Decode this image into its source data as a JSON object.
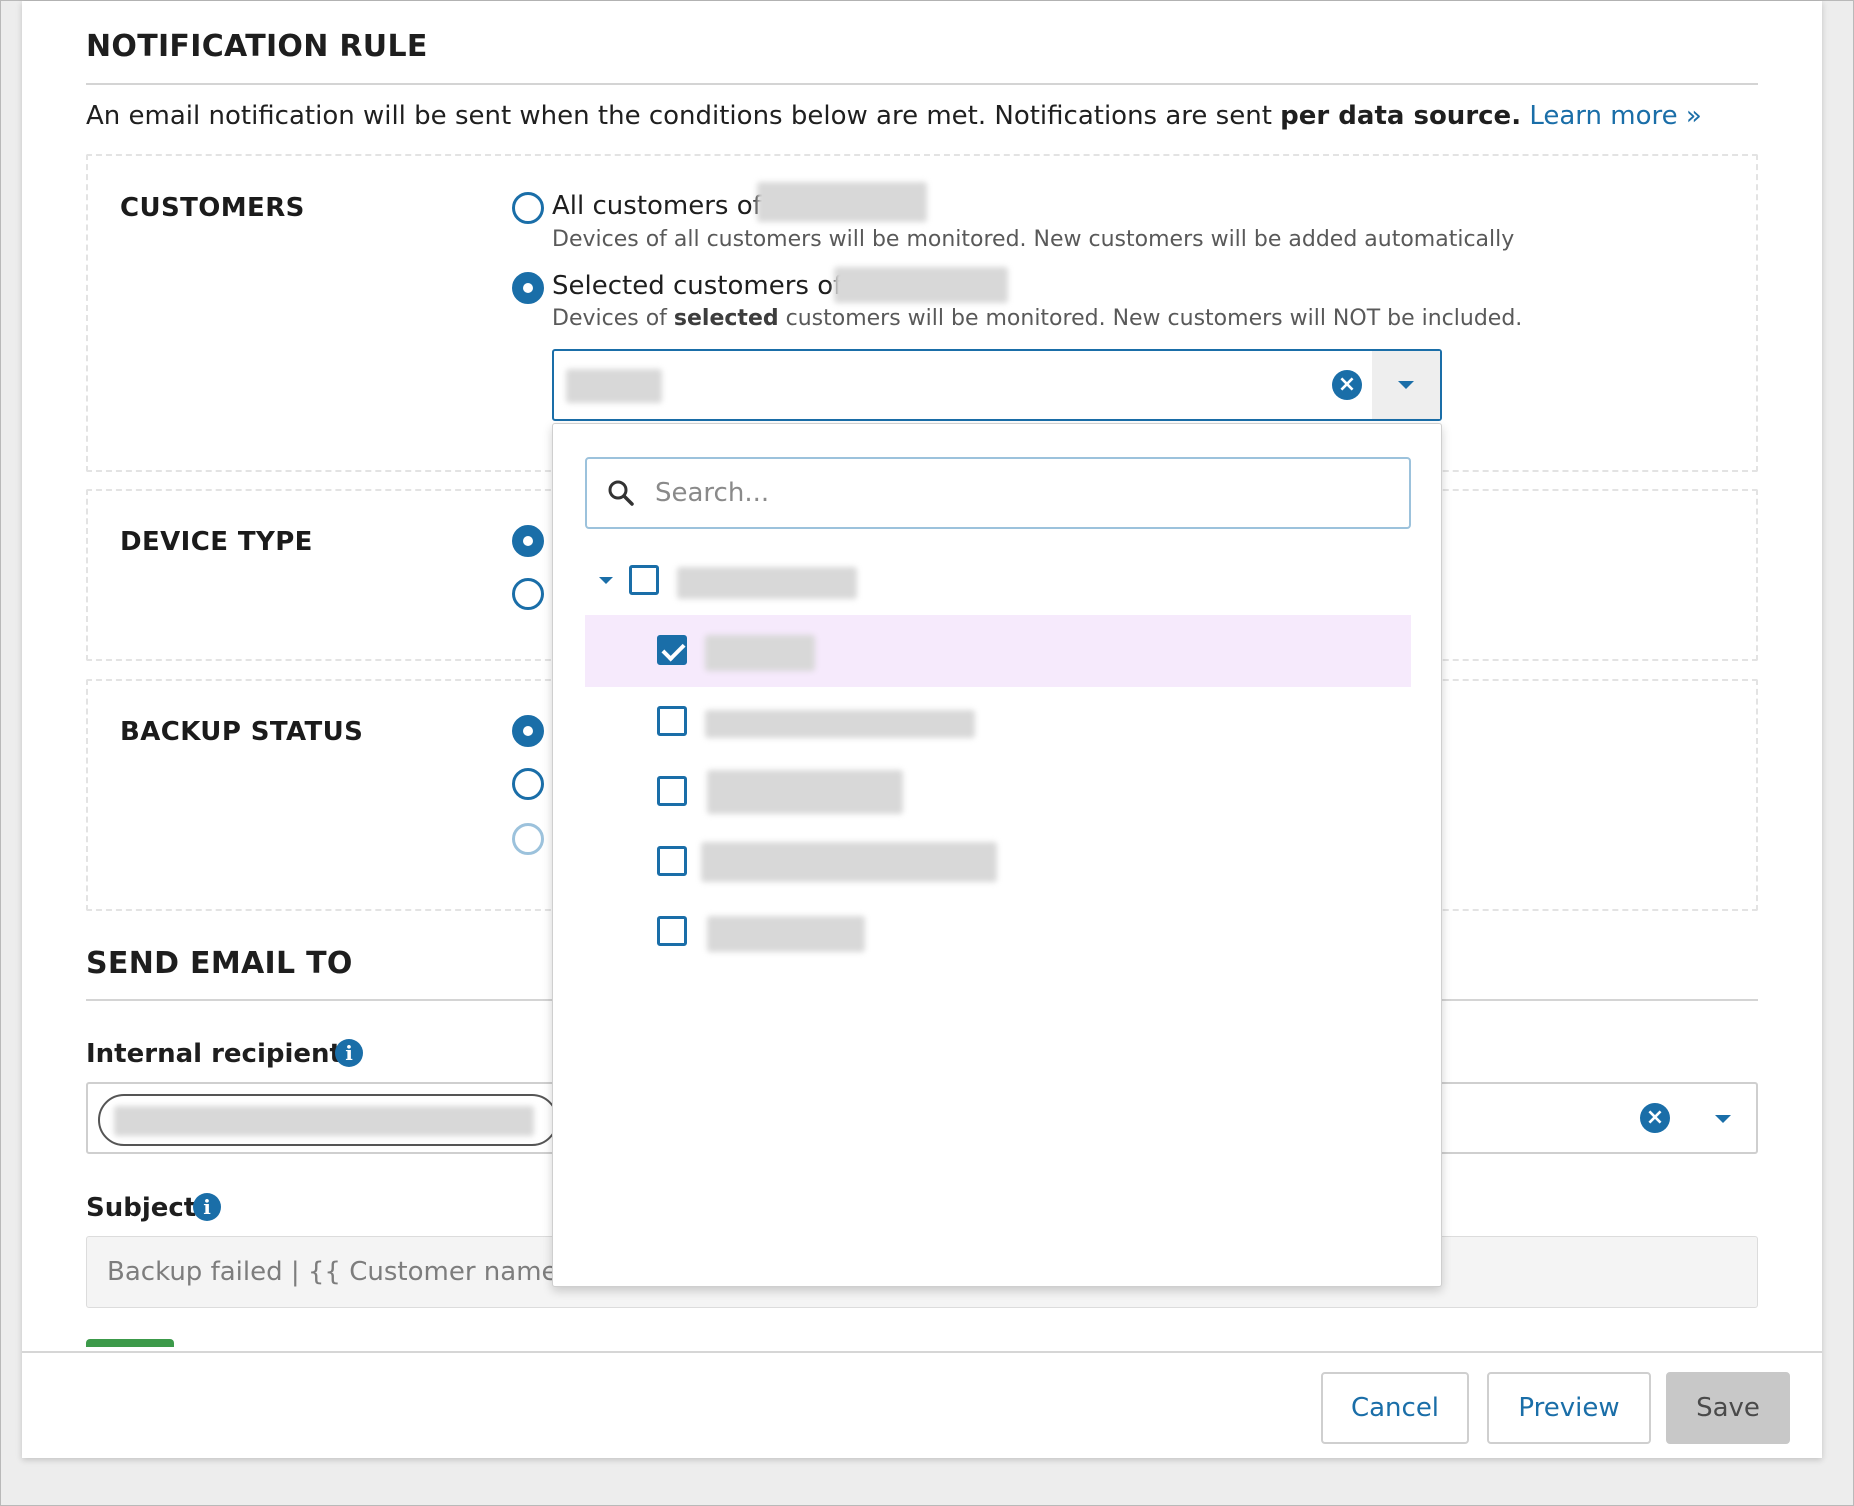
{
  "rule": {
    "title": "NOTIFICATION RULE",
    "intro_text": "An email notification will be sent when the conditions below are met. Notifications are sent ",
    "intro_bold": "per data source.",
    "learn_more": "Learn more »"
  },
  "customers": {
    "label": "CUSTOMERS",
    "all_label": "All customers of:",
    "all_help": "Devices of all customers will be monitored. New customers will be added automatically",
    "selected_label": "Selected customers of:",
    "selected_help_pre": "Devices of ",
    "selected_help_bold": "selected",
    "selected_help_post": " customers will be monitored. New customers will NOT be included.",
    "selection_mode": "selected"
  },
  "dropdown": {
    "search_placeholder": "Search...",
    "items": [
      {
        "level": 0,
        "checked": false,
        "expanded": true
      },
      {
        "level": 1,
        "checked": true,
        "highlighted": true
      },
      {
        "level": 1,
        "checked": false
      },
      {
        "level": 1,
        "checked": false
      },
      {
        "level": 1,
        "checked": false
      },
      {
        "level": 1,
        "checked": false
      }
    ]
  },
  "device_type": {
    "label": "DEVICE TYPE"
  },
  "backup_status": {
    "label": "BACKUP STATUS"
  },
  "send_email": {
    "title": "SEND EMAIL TO",
    "internal_label": "Internal recipients",
    "subject_label": "Subject",
    "subject_value": "Backup failed | {{ Customer name }}"
  },
  "footer": {
    "cancel": "Cancel",
    "preview": "Preview",
    "save": "Save"
  },
  "colors": {
    "accent": "#1a6ea8",
    "highlight_row": "#f6eafc",
    "disabled_button": "#c8c8c8"
  },
  "icons": [
    "search-icon",
    "clear-icon",
    "chevron-down-icon",
    "info-icon",
    "tree-expand-icon",
    "checkbox-icon",
    "radio-icon"
  ]
}
